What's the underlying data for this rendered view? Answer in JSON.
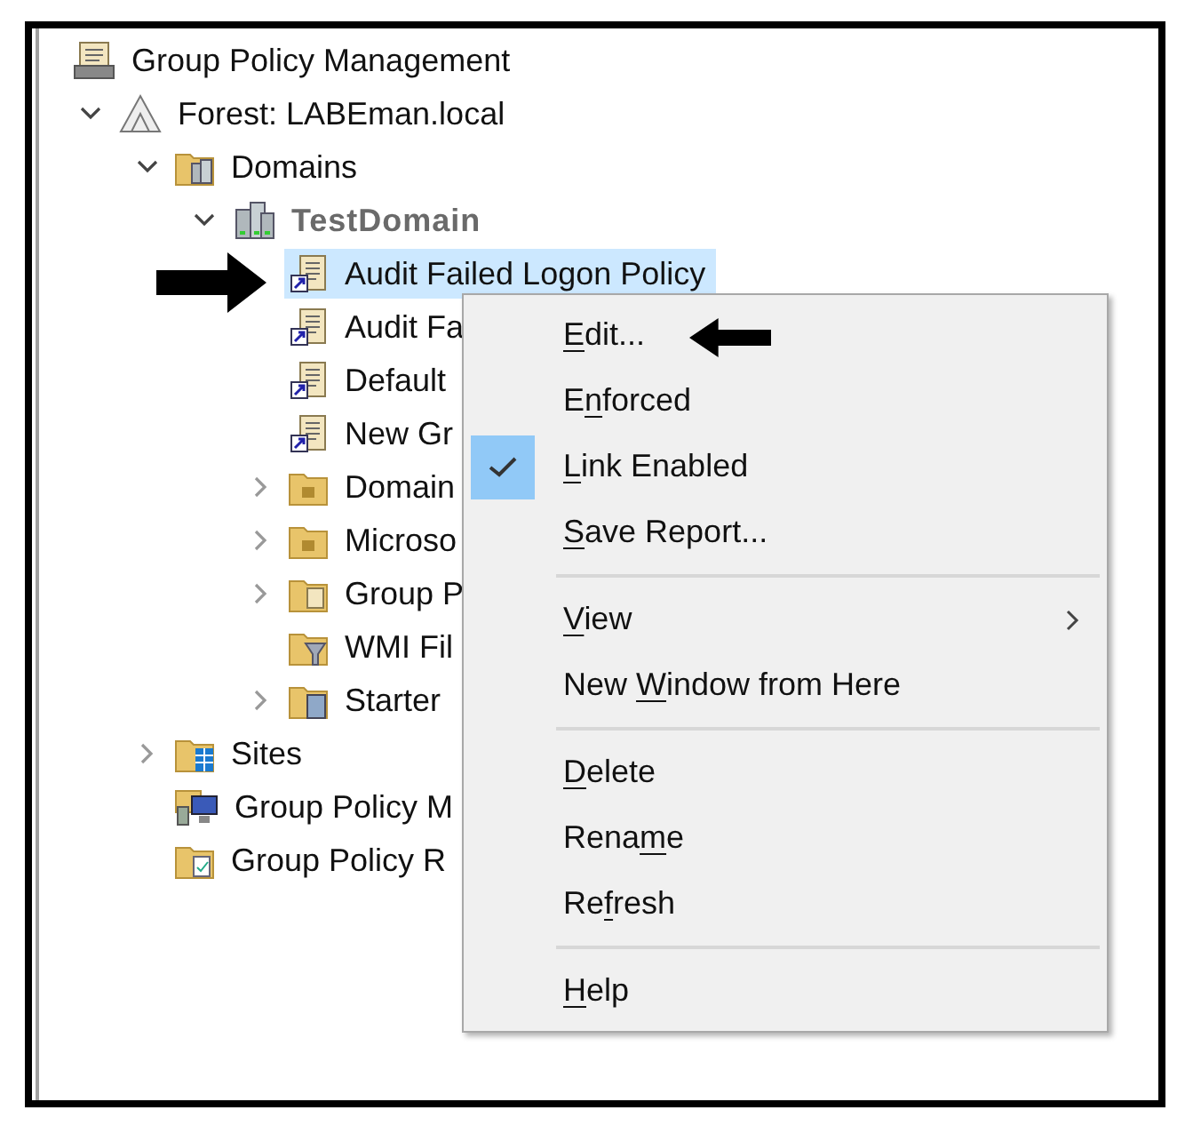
{
  "tree": [
    {
      "kind": "root",
      "label": "Group Policy Management",
      "children": [
        {
          "kind": "forest",
          "label": "Forest: LABEman.local",
          "expanded": true,
          "children": [
            {
              "kind": "domains",
              "label": "Domains",
              "expanded": true,
              "children": [
                {
                  "kind": "domain",
                  "label": "TestDomain",
                  "expanded": true,
                  "children": [
                    {
                      "kind": "gpo-link",
                      "label": "Audit Failed Logon Policy",
                      "selected": true
                    },
                    {
                      "kind": "gpo-link",
                      "label": "Audit Fa",
                      "selected": false
                    },
                    {
                      "kind": "gpo-link",
                      "label": "Default",
                      "selected": false
                    },
                    {
                      "kind": "gpo-link",
                      "label": "New Gr",
                      "selected": false
                    },
                    {
                      "kind": "ou",
                      "label": "Domain",
                      "expanded": false,
                      "selected": false
                    },
                    {
                      "kind": "ou",
                      "label": "Microso",
                      "expanded": false,
                      "selected": false
                    },
                    {
                      "kind": "gpo-folder",
                      "label": "Group P",
                      "expanded": false,
                      "selected": false
                    },
                    {
                      "kind": "wmi",
                      "label": "WMI Fil",
                      "selected": false
                    },
                    {
                      "kind": "starter",
                      "label": "Starter",
                      "expanded": false,
                      "selected": false
                    }
                  ]
                }
              ]
            },
            {
              "kind": "sites",
              "label": "Sites",
              "expanded": false,
              "selected": false
            },
            {
              "kind": "modeling",
              "label": "Group Policy M",
              "selected": false
            },
            {
              "kind": "results",
              "label": "Group Policy R",
              "selected": false
            }
          ]
        }
      ]
    }
  ],
  "context_menu": [
    {
      "kind": "item",
      "key": "E",
      "after": "dit...",
      "checked": false
    },
    {
      "kind": "item",
      "before": "E",
      "key": "n",
      "after": "forced",
      "checked": false
    },
    {
      "kind": "item",
      "key": "L",
      "after": "ink Enabled",
      "checked": true
    },
    {
      "kind": "item",
      "key": "S",
      "after": "ave Report...",
      "checked": false
    },
    {
      "kind": "separator"
    },
    {
      "kind": "submenu",
      "key": "V",
      "after": "iew",
      "checked": false
    },
    {
      "kind": "item",
      "before": "New ",
      "key": "W",
      "after": "indow from Here",
      "checked": false
    },
    {
      "kind": "separator"
    },
    {
      "kind": "item",
      "key": "D",
      "after": "elete",
      "checked": false
    },
    {
      "kind": "item",
      "before": "Rena",
      "key": "m",
      "after": "e",
      "checked": false
    },
    {
      "kind": "item",
      "before": "Re",
      "key": "f",
      "after": "resh",
      "checked": false
    },
    {
      "kind": "separator"
    },
    {
      "kind": "item",
      "key": "H",
      "after": "elp",
      "checked": false
    }
  ]
}
